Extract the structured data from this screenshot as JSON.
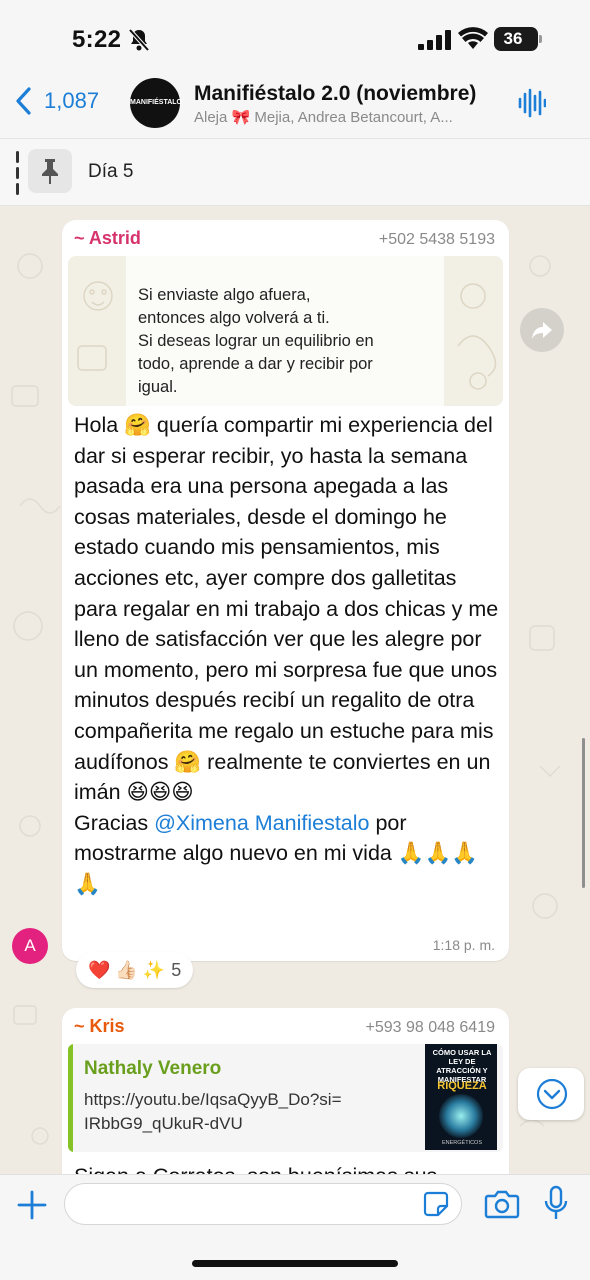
{
  "status_bar": {
    "time": "5:22",
    "battery": "36"
  },
  "header": {
    "back_count": "1,087",
    "avatar_text": "MANIFIÉSTALO",
    "title": "Manifiéstalo 2.0 (noviembre)",
    "members": "Aleja 🎀 Mejia, Andrea Betancourt, A..."
  },
  "pinned": {
    "label": "Día 5"
  },
  "messages": [
    {
      "sender": "~ Astrid",
      "sender_color": "#d6336c",
      "phone": "+502 5438 5193",
      "quote_lines": "Si enviaste algo afuera,\nentonces algo volverá a ti.\nSi deseas lograr un equilibrio en\ntodo, aprende a dar y recibir por\nigual.",
      "text_part1": "Hola 🤗 quería compartir mi experiencia del dar si esperar recibir, yo hasta la semana pasada era una persona apegada a las cosas materiales, desde el domingo he estado cuando mis pensamientos, mis acciones etc, ayer compre dos galletitas para regalar en mi trabajo a dos chicas y me lleno de satisfacción ver que les alegre por un momento, pero mi sorpresa fue que unos minutos después recibí un regalito de otra compañerita me regalo un estuche para mis audífonos 🤗 realmente te conviertes en un imán 😆😆😆",
      "text_part2": "Gracias ",
      "mention": "@Ximena Manifiestalo",
      "text_part3": " por mostrarme algo nuevo en mi vida 🙏🙏🙏🙏",
      "time": "1:18 p. m.",
      "avatar_letter": "A",
      "reactions": "❤️ 👍🏻 ✨",
      "reaction_count": "5"
    },
    {
      "sender": "~ Kris",
      "sender_color": "#e8590c",
      "phone": "+593 98 048 6419",
      "link_title": "Nathaly Venero",
      "link_url": "https://youtu.be/IqsaQyyB_Do?si=IRbbG9_qUkuR-dVU",
      "thumb_line1": "CÓMO USAR LA LEY DE ATRACCIÓN Y MANIFESTAR",
      "thumb_line2": "RIQUEZA",
      "thumb_line3": "ENERGÉTICOS",
      "partial_text": "Sigan a Corratos, son buenísimas sus"
    }
  ]
}
